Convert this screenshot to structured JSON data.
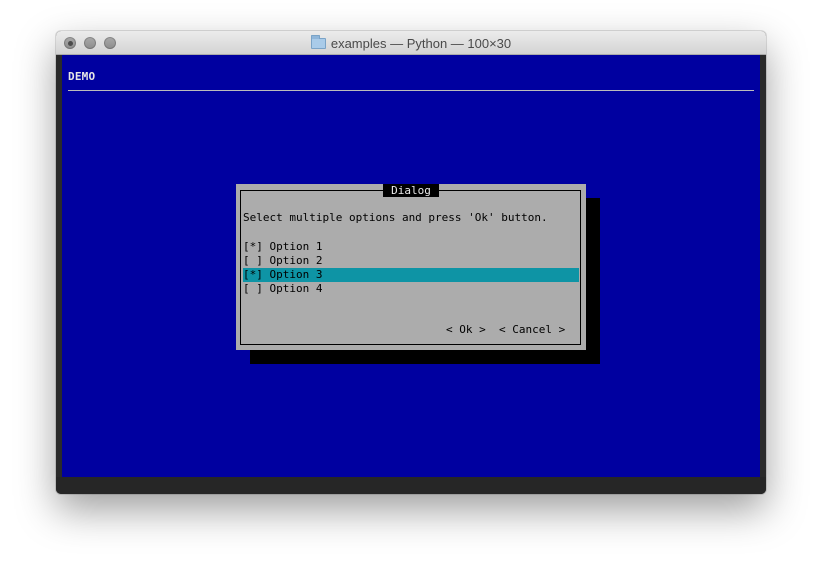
{
  "window": {
    "title": "examples — Python — 100×30"
  },
  "terminal": {
    "backtitle": "DEMO"
  },
  "dialog": {
    "title": " Dialog ",
    "text": "Select multiple options and press 'Ok' button.",
    "items": [
      {
        "checkbox": "[*]",
        "label": "Option 1",
        "checked": true,
        "selected": false
      },
      {
        "checkbox": "[ ]",
        "label": "Option 2",
        "checked": false,
        "selected": false
      },
      {
        "checkbox": "[*]",
        "label": "Option 3",
        "checked": true,
        "selected": true
      },
      {
        "checkbox": "[ ]",
        "label": "Option 4",
        "checked": false,
        "selected": false
      }
    ],
    "ok_button": "< Ok >",
    "cancel_button": "< Cancel >"
  },
  "colors": {
    "terminal_background": "#0000a0",
    "dialog_background": "#acacac",
    "highlight": "#0e94a5"
  }
}
